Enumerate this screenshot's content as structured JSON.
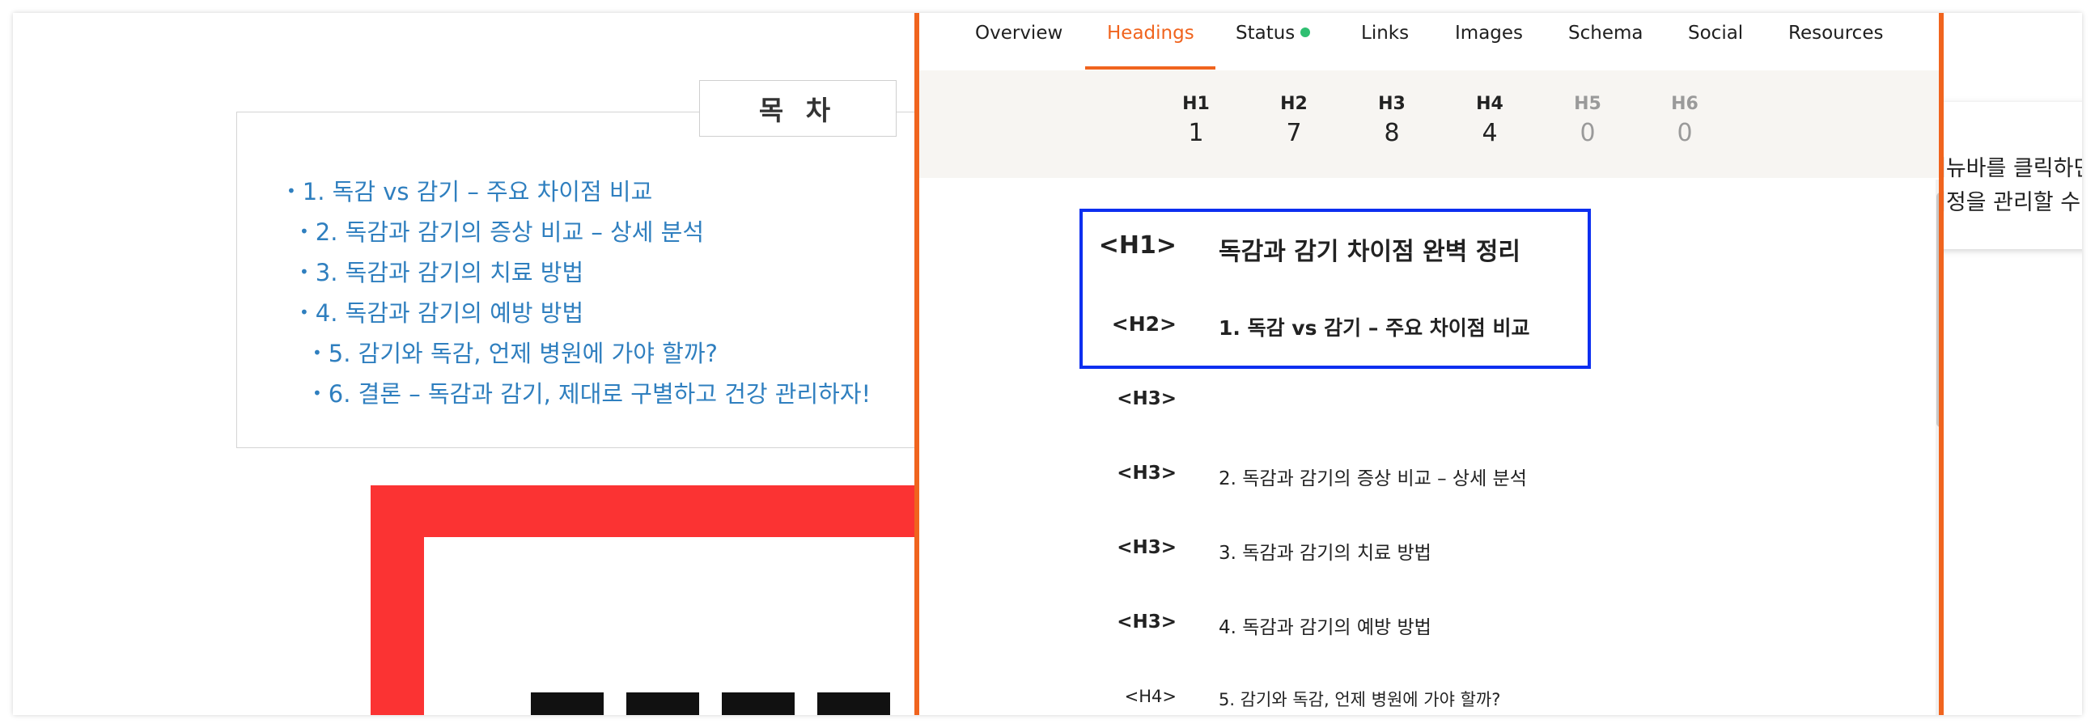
{
  "blog": {
    "toc_title": "목 차",
    "toc_items": [
      "1. 독감 vs 감기 – 주요 차이점 비교",
      "2. 독감과 감기의 증상 비교 – 상세 분석",
      "3. 독감과 감기의 치료 방법",
      "4. 독감과 감기의 예방 방법",
      "5. 감기와 독감, 언제 병원에 가야 할까?",
      "6. 결론 – 독감과 감기, 제대로 구별하고 건강 관리하자!"
    ],
    "bullet": "•",
    "popup_lines": [
      "메뉴바를 클릭하면",
      "계정을 관리할 수 있"
    ],
    "colors": {
      "link": "#2f7fbf",
      "red_block": "#fb3333"
    }
  },
  "panel": {
    "tabs": [
      "Overview",
      "Headings",
      "Status",
      "Links",
      "Images",
      "Schema",
      "Social",
      "Resources"
    ],
    "active_tab": "Headings",
    "counts": [
      {
        "label": "H1",
        "value": "1"
      },
      {
        "label": "H2",
        "value": "7"
      },
      {
        "label": "H3",
        "value": "8"
      },
      {
        "label": "H4",
        "value": "4"
      },
      {
        "label": "H5",
        "value": "0"
      },
      {
        "label": "H6",
        "value": "0"
      }
    ],
    "headings": [
      {
        "tag": "<H1>",
        "text": "독감과 감기 차이점 완벽 정리"
      },
      {
        "tag": "<H2>",
        "text": "1. 독감 vs 감기 – 주요 차이점 비교"
      },
      {
        "tag": "<H3>",
        "text": ""
      },
      {
        "tag": "<H3>",
        "text": "2. 독감과 감기의 증상 비교 – 상세 분석"
      },
      {
        "tag": "<H3>",
        "text": "3. 독감과 감기의 치료 방법"
      },
      {
        "tag": "<H3>",
        "text": "4. 독감과 감기의 예방 방법"
      },
      {
        "tag": "<H4>",
        "text": "5. 감기와 독감, 언제 병원에 가야 할까?"
      }
    ],
    "colors": {
      "accent": "#f0641e",
      "status_dot": "#2fbf71",
      "highlight": "#0d2ff0",
      "counts_bg": "#f7f5f2"
    }
  }
}
